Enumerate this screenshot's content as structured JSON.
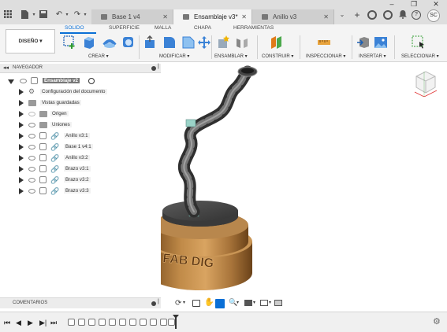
{
  "tabs": [
    {
      "label": "Base 1 v4",
      "active": false
    },
    {
      "label": "Ensamblaje v3*",
      "active": true
    },
    {
      "label": "Anillo v3",
      "active": false
    }
  ],
  "user_initials": "SC",
  "workspace_button": "DISEÑO",
  "ribbon_tabs": [
    "SOLIDO",
    "SUPERFICIE",
    "MALLA",
    "CHAPA",
    "HERRAMIENTAS"
  ],
  "ribbon_groups": [
    "CREAR",
    "MODIFICAR",
    "ENSAMBLAR",
    "CONSTRUIR",
    "INSPECCIONAR",
    "INSERTAR",
    "SELECCIONAR"
  ],
  "navigator": {
    "title": "NAVEGADOR",
    "root": "Ensamblaje v2",
    "items": [
      "Configuración del documento",
      "Vistas guardadas",
      "Origen",
      "Uniones",
      "Anillo v3:1",
      "Base 1 v4:1",
      "Anillo v3:2",
      "Brazo v3:1",
      "Brazo v3:2",
      "Brazo v3:3"
    ]
  },
  "model_engraving": "FAB DIG",
  "comments_label": "COMENTARIOS",
  "colors": {
    "accent": "#0a6fd6",
    "bronze": "#b07a3c",
    "arm": "#555555"
  },
  "icons": [
    "grid-icon",
    "file-icon",
    "save-icon",
    "undo-icon",
    "redo-icon",
    "plus-icon",
    "online-icon",
    "clock-icon",
    "bell-icon",
    "help-icon",
    "settings-icon"
  ]
}
